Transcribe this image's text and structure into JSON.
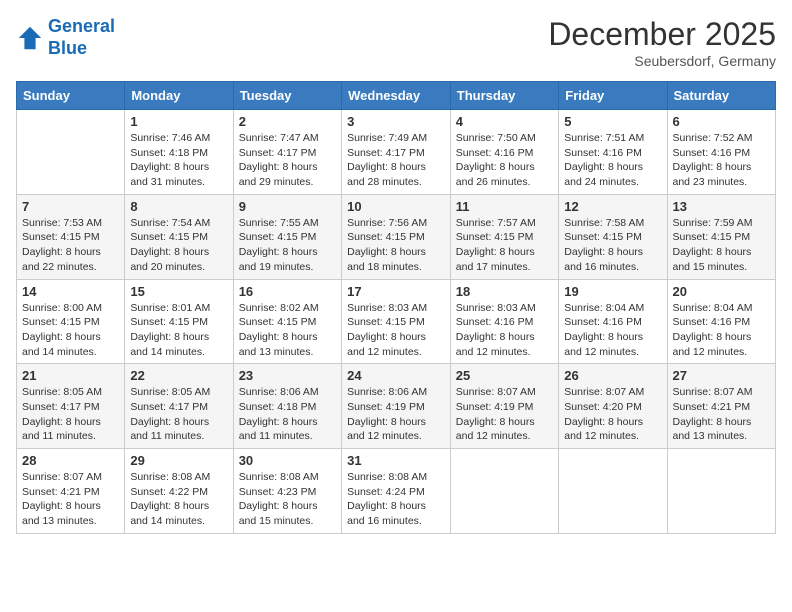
{
  "header": {
    "logo_line1": "General",
    "logo_line2": "Blue",
    "month_year": "December 2025",
    "location": "Seubersdorf, Germany"
  },
  "days_of_week": [
    "Sunday",
    "Monday",
    "Tuesday",
    "Wednesday",
    "Thursday",
    "Friday",
    "Saturday"
  ],
  "weeks": [
    [
      {
        "day": "",
        "sunrise": "",
        "sunset": "",
        "daylight": ""
      },
      {
        "day": "1",
        "sunrise": "Sunrise: 7:46 AM",
        "sunset": "Sunset: 4:18 PM",
        "daylight": "Daylight: 8 hours and 31 minutes."
      },
      {
        "day": "2",
        "sunrise": "Sunrise: 7:47 AM",
        "sunset": "Sunset: 4:17 PM",
        "daylight": "Daylight: 8 hours and 29 minutes."
      },
      {
        "day": "3",
        "sunrise": "Sunrise: 7:49 AM",
        "sunset": "Sunset: 4:17 PM",
        "daylight": "Daylight: 8 hours and 28 minutes."
      },
      {
        "day": "4",
        "sunrise": "Sunrise: 7:50 AM",
        "sunset": "Sunset: 4:16 PM",
        "daylight": "Daylight: 8 hours and 26 minutes."
      },
      {
        "day": "5",
        "sunrise": "Sunrise: 7:51 AM",
        "sunset": "Sunset: 4:16 PM",
        "daylight": "Daylight: 8 hours and 24 minutes."
      },
      {
        "day": "6",
        "sunrise": "Sunrise: 7:52 AM",
        "sunset": "Sunset: 4:16 PM",
        "daylight": "Daylight: 8 hours and 23 minutes."
      }
    ],
    [
      {
        "day": "7",
        "sunrise": "Sunrise: 7:53 AM",
        "sunset": "Sunset: 4:15 PM",
        "daylight": "Daylight: 8 hours and 22 minutes."
      },
      {
        "day": "8",
        "sunrise": "Sunrise: 7:54 AM",
        "sunset": "Sunset: 4:15 PM",
        "daylight": "Daylight: 8 hours and 20 minutes."
      },
      {
        "day": "9",
        "sunrise": "Sunrise: 7:55 AM",
        "sunset": "Sunset: 4:15 PM",
        "daylight": "Daylight: 8 hours and 19 minutes."
      },
      {
        "day": "10",
        "sunrise": "Sunrise: 7:56 AM",
        "sunset": "Sunset: 4:15 PM",
        "daylight": "Daylight: 8 hours and 18 minutes."
      },
      {
        "day": "11",
        "sunrise": "Sunrise: 7:57 AM",
        "sunset": "Sunset: 4:15 PM",
        "daylight": "Daylight: 8 hours and 17 minutes."
      },
      {
        "day": "12",
        "sunrise": "Sunrise: 7:58 AM",
        "sunset": "Sunset: 4:15 PM",
        "daylight": "Daylight: 8 hours and 16 minutes."
      },
      {
        "day": "13",
        "sunrise": "Sunrise: 7:59 AM",
        "sunset": "Sunset: 4:15 PM",
        "daylight": "Daylight: 8 hours and 15 minutes."
      }
    ],
    [
      {
        "day": "14",
        "sunrise": "Sunrise: 8:00 AM",
        "sunset": "Sunset: 4:15 PM",
        "daylight": "Daylight: 8 hours and 14 minutes."
      },
      {
        "day": "15",
        "sunrise": "Sunrise: 8:01 AM",
        "sunset": "Sunset: 4:15 PM",
        "daylight": "Daylight: 8 hours and 14 minutes."
      },
      {
        "day": "16",
        "sunrise": "Sunrise: 8:02 AM",
        "sunset": "Sunset: 4:15 PM",
        "daylight": "Daylight: 8 hours and 13 minutes."
      },
      {
        "day": "17",
        "sunrise": "Sunrise: 8:03 AM",
        "sunset": "Sunset: 4:15 PM",
        "daylight": "Daylight: 8 hours and 12 minutes."
      },
      {
        "day": "18",
        "sunrise": "Sunrise: 8:03 AM",
        "sunset": "Sunset: 4:16 PM",
        "daylight": "Daylight: 8 hours and 12 minutes."
      },
      {
        "day": "19",
        "sunrise": "Sunrise: 8:04 AM",
        "sunset": "Sunset: 4:16 PM",
        "daylight": "Daylight: 8 hours and 12 minutes."
      },
      {
        "day": "20",
        "sunrise": "Sunrise: 8:04 AM",
        "sunset": "Sunset: 4:16 PM",
        "daylight": "Daylight: 8 hours and 12 minutes."
      }
    ],
    [
      {
        "day": "21",
        "sunrise": "Sunrise: 8:05 AM",
        "sunset": "Sunset: 4:17 PM",
        "daylight": "Daylight: 8 hours and 11 minutes."
      },
      {
        "day": "22",
        "sunrise": "Sunrise: 8:05 AM",
        "sunset": "Sunset: 4:17 PM",
        "daylight": "Daylight: 8 hours and 11 minutes."
      },
      {
        "day": "23",
        "sunrise": "Sunrise: 8:06 AM",
        "sunset": "Sunset: 4:18 PM",
        "daylight": "Daylight: 8 hours and 11 minutes."
      },
      {
        "day": "24",
        "sunrise": "Sunrise: 8:06 AM",
        "sunset": "Sunset: 4:19 PM",
        "daylight": "Daylight: 8 hours and 12 minutes."
      },
      {
        "day": "25",
        "sunrise": "Sunrise: 8:07 AM",
        "sunset": "Sunset: 4:19 PM",
        "daylight": "Daylight: 8 hours and 12 minutes."
      },
      {
        "day": "26",
        "sunrise": "Sunrise: 8:07 AM",
        "sunset": "Sunset: 4:20 PM",
        "daylight": "Daylight: 8 hours and 12 minutes."
      },
      {
        "day": "27",
        "sunrise": "Sunrise: 8:07 AM",
        "sunset": "Sunset: 4:21 PM",
        "daylight": "Daylight: 8 hours and 13 minutes."
      }
    ],
    [
      {
        "day": "28",
        "sunrise": "Sunrise: 8:07 AM",
        "sunset": "Sunset: 4:21 PM",
        "daylight": "Daylight: 8 hours and 13 minutes."
      },
      {
        "day": "29",
        "sunrise": "Sunrise: 8:08 AM",
        "sunset": "Sunset: 4:22 PM",
        "daylight": "Daylight: 8 hours and 14 minutes."
      },
      {
        "day": "30",
        "sunrise": "Sunrise: 8:08 AM",
        "sunset": "Sunset: 4:23 PM",
        "daylight": "Daylight: 8 hours and 15 minutes."
      },
      {
        "day": "31",
        "sunrise": "Sunrise: 8:08 AM",
        "sunset": "Sunset: 4:24 PM",
        "daylight": "Daylight: 8 hours and 16 minutes."
      },
      {
        "day": "",
        "sunrise": "",
        "sunset": "",
        "daylight": ""
      },
      {
        "day": "",
        "sunrise": "",
        "sunset": "",
        "daylight": ""
      },
      {
        "day": "",
        "sunrise": "",
        "sunset": "",
        "daylight": ""
      }
    ]
  ]
}
